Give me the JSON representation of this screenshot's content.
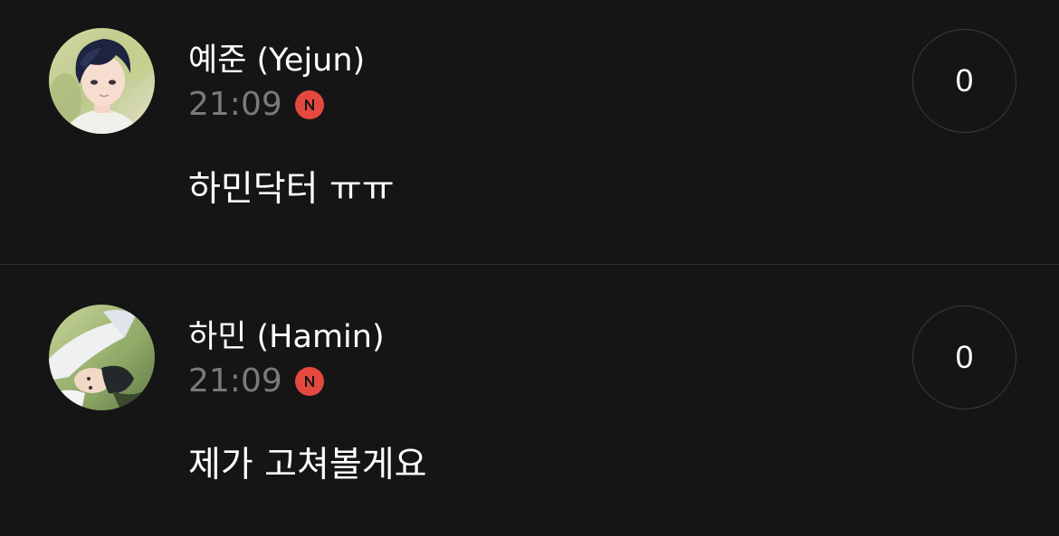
{
  "comments": [
    {
      "author": "예준 (Yejun)",
      "time": "21:09",
      "badge": "N",
      "text": "하민닥터 ㅠㅠ",
      "like_count": "0"
    },
    {
      "author": "하민 (Hamin)",
      "time": "21:09",
      "badge": "N",
      "text": "제가 고쳐볼게요",
      "like_count": "0"
    }
  ],
  "colors": {
    "background": "#151515",
    "divider": "#2e2e2e",
    "time_text": "#7a7a7a",
    "new_badge": "#e5483f",
    "like_border": "#3b3b3b"
  },
  "icons": {
    "new_badge": "new-n-icon",
    "avatar": "profile-avatar"
  }
}
